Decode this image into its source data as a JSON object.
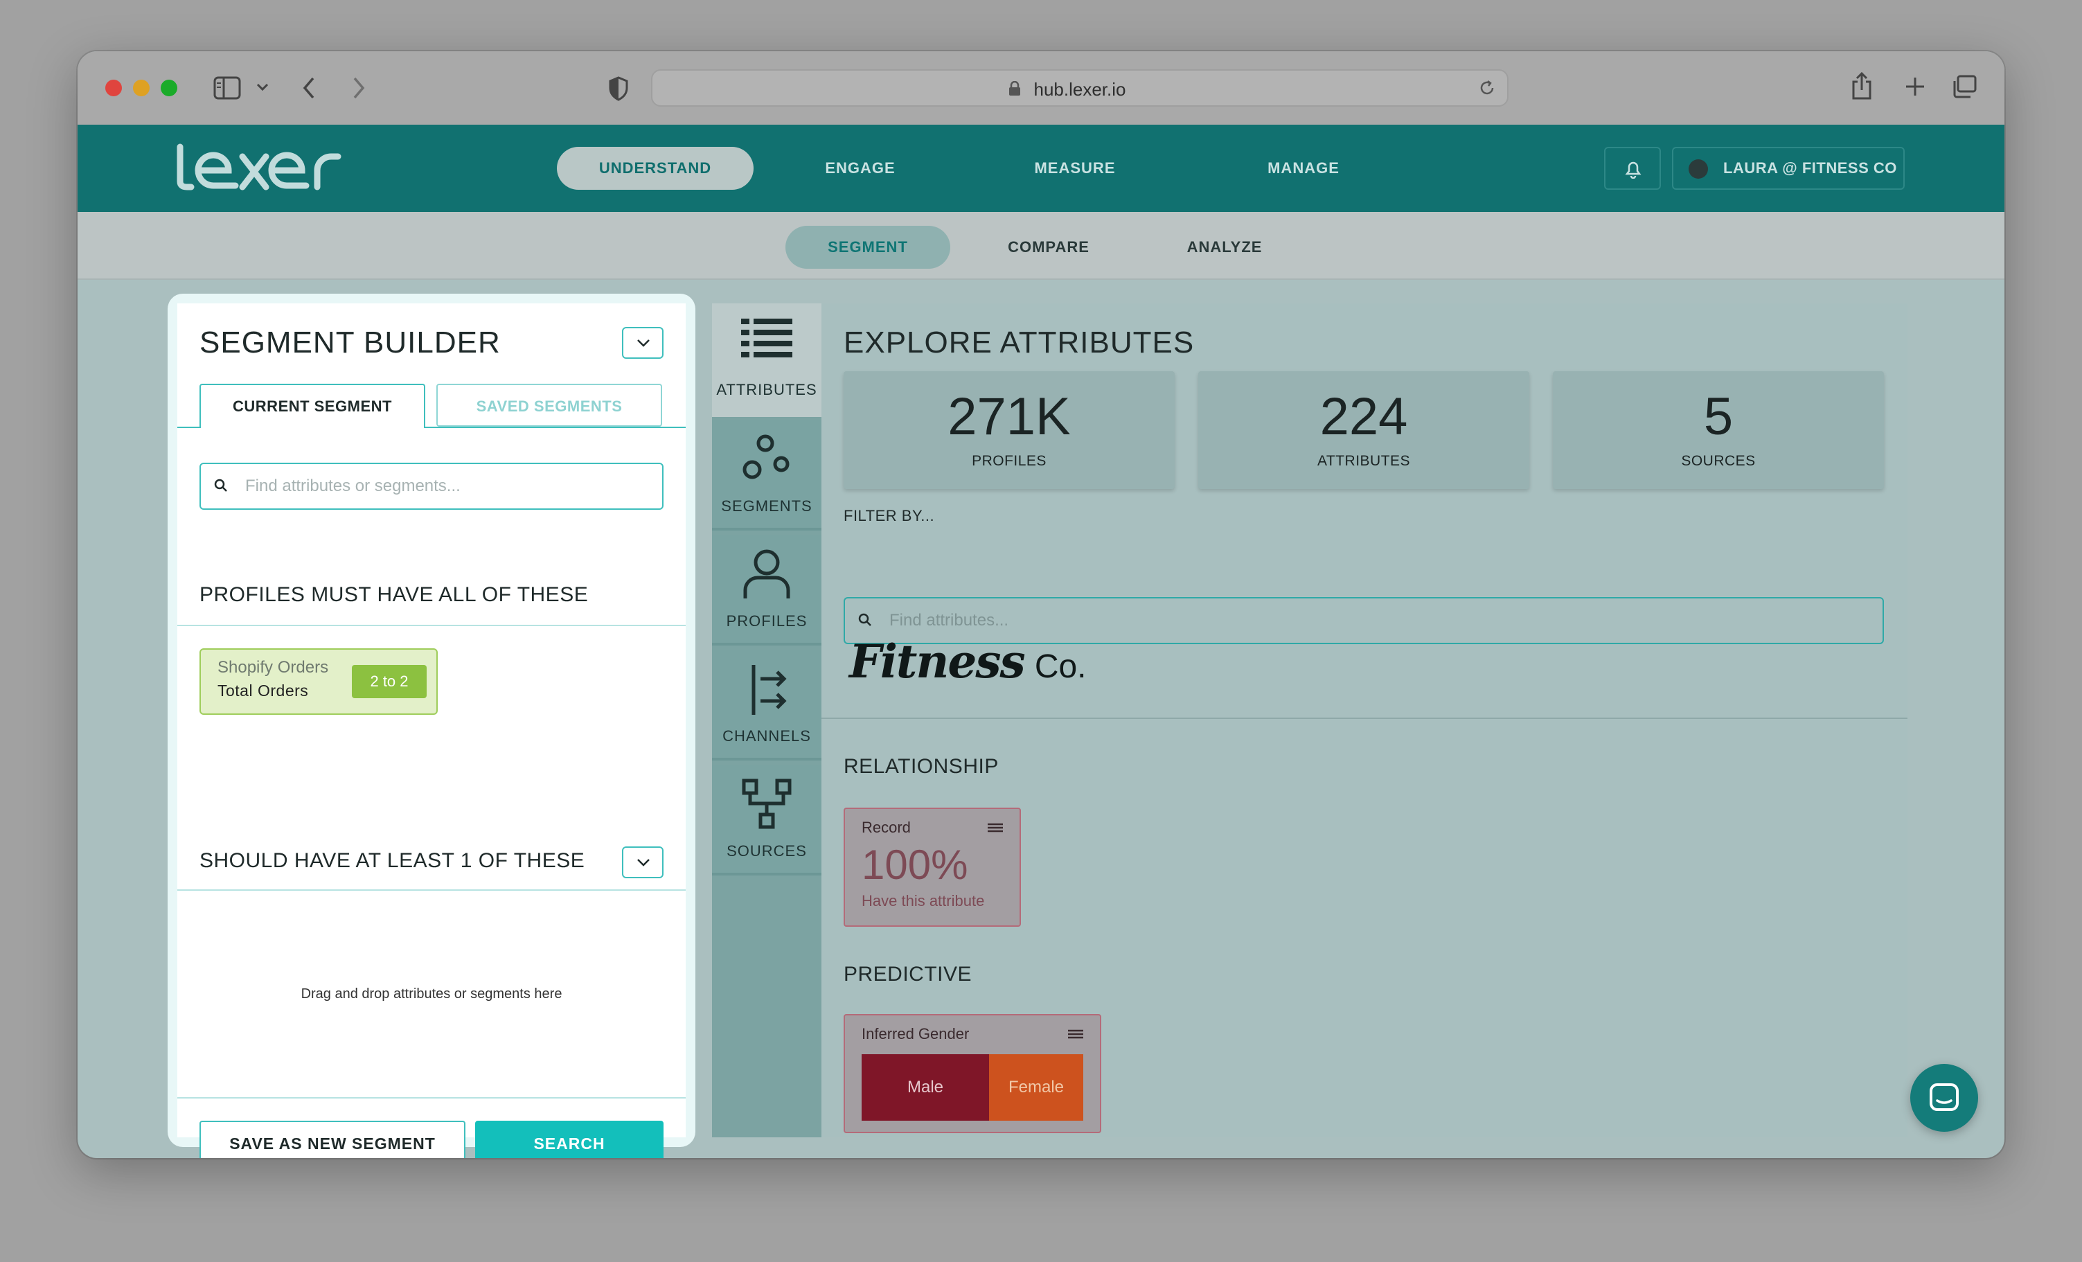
{
  "browser": {
    "url": "hub.lexer.io",
    "traffic_lights": {
      "close": "#e0443e",
      "minimize": "#dea123",
      "zoom": "#1aab29"
    }
  },
  "brand": {
    "logo_text": "lexer",
    "primary_color": "#117170",
    "accent_color": "#13bfbb"
  },
  "top_nav": {
    "items": [
      {
        "label": "UNDERSTAND",
        "active": true
      },
      {
        "label": "ENGAGE",
        "active": false
      },
      {
        "label": "MEASURE",
        "active": false
      },
      {
        "label": "MANAGE",
        "active": false
      }
    ],
    "user_label": "LAURA @ FITNESS CO",
    "bell_icon": "bell-icon"
  },
  "sub_nav": {
    "items": [
      {
        "label": "SEGMENT",
        "active": true
      },
      {
        "label": "COMPARE",
        "active": false
      },
      {
        "label": "ANALYZE",
        "active": false
      }
    ]
  },
  "segment_builder": {
    "title": "SEGMENT BUILDER",
    "tabs": [
      {
        "label": "CURRENT SEGMENT",
        "active": true
      },
      {
        "label": "SAVED SEGMENTS",
        "active": false
      }
    ],
    "search_placeholder": "Find attributes or segments...",
    "must_title": "PROFILES MUST HAVE ALL OF THESE",
    "chip": {
      "source": "Shopify Orders",
      "attribute": "Total Orders",
      "range": "2 to 2"
    },
    "should_title": "SHOULD HAVE AT LEAST 1 OF THESE",
    "drop_hint": "Drag and drop attributes or segments here",
    "save_label": "SAVE AS NEW SEGMENT",
    "search_label": "SEARCH"
  },
  "side_rail": {
    "items": [
      {
        "label": "ATTRIBUTES",
        "icon": "list-icon",
        "active": true
      },
      {
        "label": "SEGMENTS",
        "icon": "segments-icon",
        "active": false
      },
      {
        "label": "PROFILES",
        "icon": "profile-icon",
        "active": false
      },
      {
        "label": "CHANNELS",
        "icon": "channels-icon",
        "active": false
      },
      {
        "label": "SOURCES",
        "icon": "sources-icon",
        "active": false
      }
    ]
  },
  "explore": {
    "title": "EXPLORE ATTRIBUTES",
    "stats": [
      {
        "value": "271K",
        "label": "PROFILES"
      },
      {
        "value": "224",
        "label": "ATTRIBUTES"
      },
      {
        "value": "5",
        "label": "SOURCES"
      }
    ],
    "filter_label": "FILTER BY...",
    "filter_placeholder": "Find attributes...",
    "brand_logo": {
      "script": "Fitness",
      "suffix": "Co."
    },
    "relationship": {
      "title": "RELATIONSHIP",
      "card_label": "Record",
      "value": "100%",
      "caption": "Have this attribute"
    },
    "predictive": {
      "title": "PREDICTIVE",
      "card_label": "Inferred Gender",
      "male_label": "Male",
      "female_label": "Female",
      "male_share": 0.575,
      "female_share": 0.425
    }
  }
}
